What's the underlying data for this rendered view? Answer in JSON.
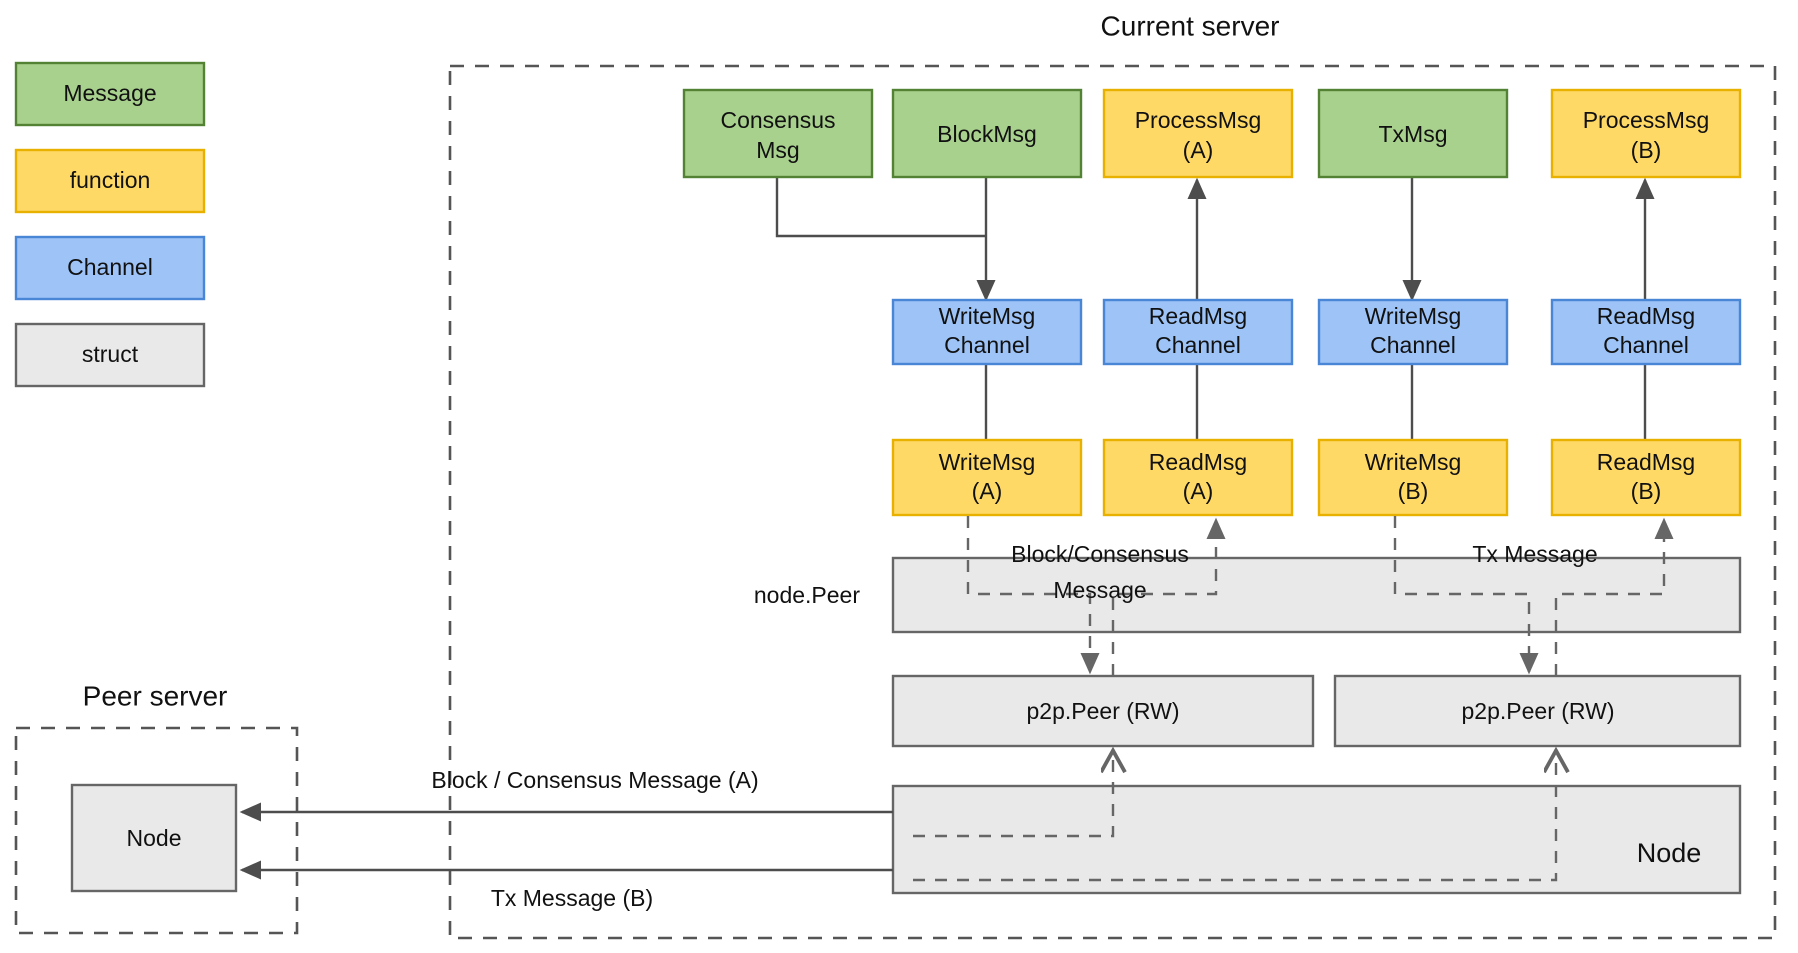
{
  "legend": {
    "items": [
      {
        "label": "Message",
        "fill": "#a9d18e",
        "stroke": "#548235"
      },
      {
        "label": "function",
        "fill": "#ffd966",
        "stroke": "#e8b100"
      },
      {
        "label": "Channel",
        "fill": "#9dc3f7",
        "stroke": "#4a86d6"
      },
      {
        "label": "struct",
        "fill": "#e9e9e9",
        "stroke": "#666666"
      }
    ]
  },
  "frames": {
    "current_server": {
      "title": "Current server"
    },
    "peer_server": {
      "title": "Peer server"
    }
  },
  "messages": {
    "consensus_msg": "Consensus\nMsg",
    "consensus_msg_line1": "Consensus",
    "consensus_msg_line2": "Msg",
    "block_msg": "BlockMsg",
    "tx_msg": "TxMsg"
  },
  "functions": {
    "process_msg_a_line1": "ProcessMsg",
    "process_msg_a_line2": "(A)",
    "process_msg_b_line1": "ProcessMsg",
    "process_msg_b_line2": "(B)",
    "write_msg_a_line1": "WriteMsg",
    "write_msg_a_line2": "(A)",
    "read_msg_a_line1": "ReadMsg",
    "read_msg_a_line2": "(A)",
    "write_msg_b_line1": "WriteMsg",
    "write_msg_b_line2": "(B)",
    "read_msg_b_line1": "ReadMsg",
    "read_msg_b_line2": "(B)"
  },
  "channels": {
    "write_channel_a_line1": "WriteMsg",
    "write_channel_a_line2": "Channel",
    "read_channel_a_line1": "ReadMsg",
    "read_channel_a_line2": "Channel",
    "write_channel_b_line1": "WriteMsg",
    "write_channel_b_line2": "Channel",
    "read_channel_b_line1": "ReadMsg",
    "read_channel_b_line2": "Channel"
  },
  "structs": {
    "node_peer_label": "node.Peer",
    "p2p_peer_a": "p2p.Peer (RW)",
    "p2p_peer_b": "p2p.Peer (RW)",
    "node_right": "Node",
    "node_peer_server": "Node"
  },
  "edge_labels": {
    "block_consensus_line1": "Block/Consensus",
    "block_consensus_line2": "Message",
    "tx_message": "Tx Message",
    "block_consensus_a": "Block / Consensus Message (A)",
    "tx_message_b": "Tx Message (B)"
  },
  "colors": {
    "message_fill": "#a9d18e",
    "message_stroke": "#548235",
    "function_fill": "#ffd966",
    "function_stroke": "#e8b100",
    "channel_fill": "#9dc3f7",
    "channel_stroke": "#4a86d6",
    "struct_fill": "#e9e9e9",
    "struct_stroke": "#666666",
    "line": "#4d4d4d",
    "dashed_line": "#666666"
  }
}
